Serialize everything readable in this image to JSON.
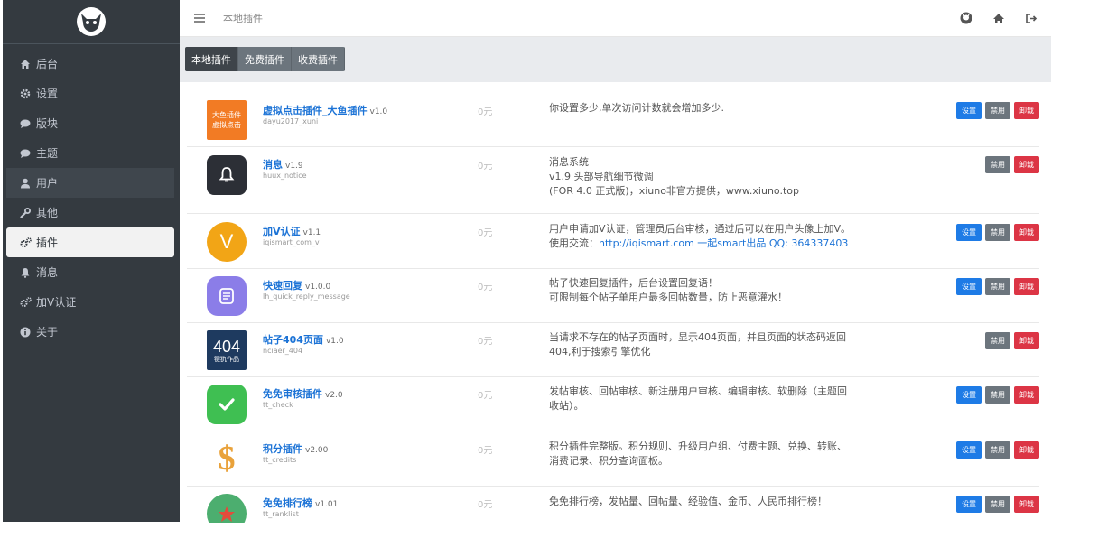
{
  "sidebar": {
    "items": [
      {
        "label": "后台",
        "icon": "home-icon"
      },
      {
        "label": "设置",
        "icon": "gear-icon"
      },
      {
        "label": "版块",
        "icon": "comment-icon"
      },
      {
        "label": "主题",
        "icon": "comment-icon"
      },
      {
        "label": "用户",
        "icon": "user-icon"
      },
      {
        "label": "其他",
        "icon": "wrench-icon"
      },
      {
        "label": "插件",
        "icon": "cogs-icon"
      },
      {
        "label": "消息",
        "icon": "bell-icon"
      },
      {
        "label": "加V认证",
        "icon": "cogs-icon"
      },
      {
        "label": "关于",
        "icon": "info-icon"
      }
    ],
    "active_index": 6
  },
  "header": {
    "breadcrumb": "本地插件",
    "icons": [
      "github-icon",
      "home-icon",
      "sign-out-icon"
    ]
  },
  "tabs": [
    {
      "label": "本地插件",
      "active": true
    },
    {
      "label": "免费插件",
      "active": false
    },
    {
      "label": "收费插件",
      "active": false
    }
  ],
  "buttons": {
    "settings": "设置",
    "disable": "禁用",
    "uninstall": "卸载"
  },
  "plugins": [
    {
      "name": "虚拟点击插件_大鱼插件",
      "version": "v1.0",
      "dir": "dayu2017_xuni",
      "price": "0元",
      "desc": "你设置多少,单次访问计数就会增加多少.",
      "icon_text": "大鱼插件\n虚拟点击",
      "icon_color": "#f27b24",
      "has_settings": true
    },
    {
      "name": "消息",
      "version": "v1.9",
      "dir": "huux_notice",
      "price": "0元",
      "desc_lines": [
        "消息系统",
        "v1.9 头部导航细节微调",
        "(FOR 4.0 正式版)，xiuno非官方提供，www.xiuno.top"
      ],
      "icon_color": "#2c2f36",
      "has_settings": false
    },
    {
      "name": "加V认证",
      "version": "v1.1",
      "dir": "iqismart_com_v",
      "price": "0元",
      "desc": "用户申请加V认证，管理员后台审核，通过后可以在用户头像上加V。使用交流：",
      "desc_link": "http://iqismart.com 一起smart出品 QQ: 364337403",
      "icon_text": "V",
      "icon_color": "#f2a516",
      "has_settings": true
    },
    {
      "name": "快速回复",
      "version": "v1.0.0",
      "dir": "lh_quick_reply_message",
      "price": "0元",
      "desc_lines": [
        "帖子快速回复插件，后台设置回复语！",
        "可限制每个帖子单用户最多回帖数量，防止恶意灌水！"
      ],
      "icon_color": "#8b7de8",
      "has_settings": true
    },
    {
      "name": "帖子404页面",
      "version": "v1.0",
      "dir": "nciaer_404",
      "price": "0元",
      "desc": "当请求不存在的帖子页面时，显示404页面，并且页面的状态码返回404,利于搜索引擎优化",
      "icon_text": "404",
      "icon_subtext": "犍犰作品",
      "icon_color": "#1e3a5f",
      "has_settings": false
    },
    {
      "name": "免免审核插件",
      "version": "v2.0",
      "dir": "tt_check",
      "price": "0元",
      "desc": "发帖审核、回帖审核、新注册用户审核、编辑审核、软删除（主题回收站）。",
      "icon_color": "#3fbf52",
      "has_settings": true
    },
    {
      "name": "积分插件",
      "version": "v2.00",
      "dir": "tt_credits",
      "price": "0元",
      "desc": "积分插件完整版。积分规则、升级用户组、付费主题、兑换、转账、消费记录、积分查询面板。",
      "icon_text": "$",
      "icon_color": "#e9a23b",
      "has_settings": true
    },
    {
      "name": "免免排行榜",
      "version": "v1.01",
      "dir": "tt_ranklist",
      "price": "0元",
      "desc": "免免排行榜，发帖量、回帖量、经验值、金币、人民币排行榜！",
      "icon_color": "#4cae6f",
      "has_settings": true
    }
  ]
}
